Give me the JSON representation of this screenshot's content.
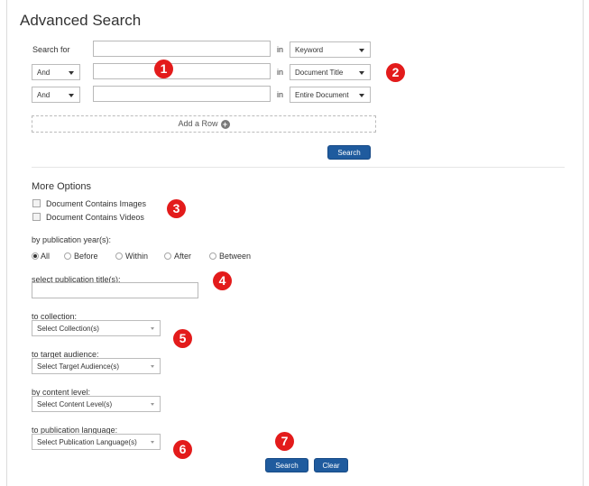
{
  "title": "Advanced Search",
  "search": {
    "rows": [
      {
        "prefix_label": "Search for",
        "value": "",
        "in_label": "in",
        "field": "Keyword"
      },
      {
        "operator": "And",
        "value": "",
        "in_label": "in",
        "field": "Document Title"
      },
      {
        "operator": "And",
        "value": "",
        "in_label": "in",
        "field": "Entire Document"
      }
    ],
    "add_row_label": "Add a Row",
    "search_button": "Search"
  },
  "more_options": {
    "heading": "More Options",
    "checkboxes": [
      {
        "label": "Document Contains Images",
        "checked": false
      },
      {
        "label": "Document Contains Videos",
        "checked": false
      }
    ],
    "pub_year": {
      "label": "by publication year(s):",
      "options": [
        {
          "label": "All",
          "checked": true
        },
        {
          "label": "Before",
          "checked": false
        },
        {
          "label": "Within",
          "checked": false
        },
        {
          "label": "After",
          "checked": false
        },
        {
          "label": "Between",
          "checked": false
        }
      ]
    },
    "pub_title": {
      "label": "select publication title(s):",
      "value": ""
    },
    "collection": {
      "label": "to collection:",
      "value": "Select Collection(s)"
    },
    "audience": {
      "label": "to target audience:",
      "value": "Select Target Audience(s)"
    },
    "content_level": {
      "label": "by content level:",
      "value": "Select Content Level(s)"
    },
    "language": {
      "label": "to publication language:",
      "value": "Select Publication Language(s)"
    }
  },
  "footer": {
    "search_button": "Search",
    "clear_button": "Clear"
  },
  "markers": [
    "1",
    "2",
    "3",
    "4",
    "5",
    "6",
    "7"
  ],
  "colors": {
    "marker": "#e31b1b",
    "button": "#1f5b9e"
  }
}
